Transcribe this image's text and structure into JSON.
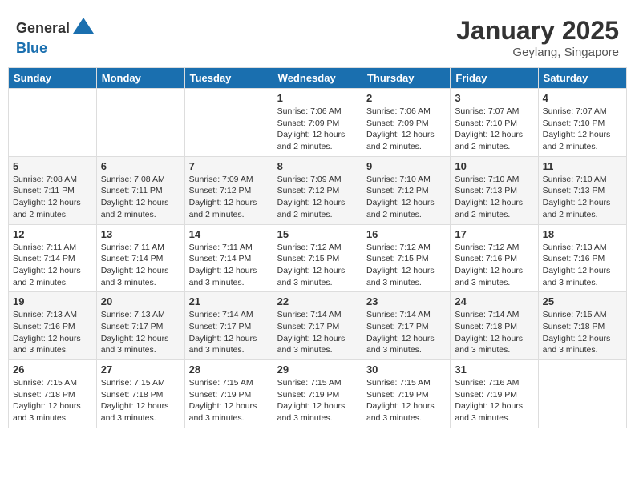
{
  "logo": {
    "general": "General",
    "blue": "Blue"
  },
  "title": "January 2025",
  "location": "Geylang, Singapore",
  "days_of_week": [
    "Sunday",
    "Monday",
    "Tuesday",
    "Wednesday",
    "Thursday",
    "Friday",
    "Saturday"
  ],
  "weeks": [
    [
      {
        "day": "",
        "info": ""
      },
      {
        "day": "",
        "info": ""
      },
      {
        "day": "",
        "info": ""
      },
      {
        "day": "1",
        "info": "Sunrise: 7:06 AM\nSunset: 7:09 PM\nDaylight: 12 hours and 2 minutes."
      },
      {
        "day": "2",
        "info": "Sunrise: 7:06 AM\nSunset: 7:09 PM\nDaylight: 12 hours and 2 minutes."
      },
      {
        "day": "3",
        "info": "Sunrise: 7:07 AM\nSunset: 7:10 PM\nDaylight: 12 hours and 2 minutes."
      },
      {
        "day": "4",
        "info": "Sunrise: 7:07 AM\nSunset: 7:10 PM\nDaylight: 12 hours and 2 minutes."
      }
    ],
    [
      {
        "day": "5",
        "info": "Sunrise: 7:08 AM\nSunset: 7:11 PM\nDaylight: 12 hours and 2 minutes."
      },
      {
        "day": "6",
        "info": "Sunrise: 7:08 AM\nSunset: 7:11 PM\nDaylight: 12 hours and 2 minutes."
      },
      {
        "day": "7",
        "info": "Sunrise: 7:09 AM\nSunset: 7:12 PM\nDaylight: 12 hours and 2 minutes."
      },
      {
        "day": "8",
        "info": "Sunrise: 7:09 AM\nSunset: 7:12 PM\nDaylight: 12 hours and 2 minutes."
      },
      {
        "day": "9",
        "info": "Sunrise: 7:10 AM\nSunset: 7:12 PM\nDaylight: 12 hours and 2 minutes."
      },
      {
        "day": "10",
        "info": "Sunrise: 7:10 AM\nSunset: 7:13 PM\nDaylight: 12 hours and 2 minutes."
      },
      {
        "day": "11",
        "info": "Sunrise: 7:10 AM\nSunset: 7:13 PM\nDaylight: 12 hours and 2 minutes."
      }
    ],
    [
      {
        "day": "12",
        "info": "Sunrise: 7:11 AM\nSunset: 7:14 PM\nDaylight: 12 hours and 2 minutes."
      },
      {
        "day": "13",
        "info": "Sunrise: 7:11 AM\nSunset: 7:14 PM\nDaylight: 12 hours and 3 minutes."
      },
      {
        "day": "14",
        "info": "Sunrise: 7:11 AM\nSunset: 7:14 PM\nDaylight: 12 hours and 3 minutes."
      },
      {
        "day": "15",
        "info": "Sunrise: 7:12 AM\nSunset: 7:15 PM\nDaylight: 12 hours and 3 minutes."
      },
      {
        "day": "16",
        "info": "Sunrise: 7:12 AM\nSunset: 7:15 PM\nDaylight: 12 hours and 3 minutes."
      },
      {
        "day": "17",
        "info": "Sunrise: 7:12 AM\nSunset: 7:16 PM\nDaylight: 12 hours and 3 minutes."
      },
      {
        "day": "18",
        "info": "Sunrise: 7:13 AM\nSunset: 7:16 PM\nDaylight: 12 hours and 3 minutes."
      }
    ],
    [
      {
        "day": "19",
        "info": "Sunrise: 7:13 AM\nSunset: 7:16 PM\nDaylight: 12 hours and 3 minutes."
      },
      {
        "day": "20",
        "info": "Sunrise: 7:13 AM\nSunset: 7:17 PM\nDaylight: 12 hours and 3 minutes."
      },
      {
        "day": "21",
        "info": "Sunrise: 7:14 AM\nSunset: 7:17 PM\nDaylight: 12 hours and 3 minutes."
      },
      {
        "day": "22",
        "info": "Sunrise: 7:14 AM\nSunset: 7:17 PM\nDaylight: 12 hours and 3 minutes."
      },
      {
        "day": "23",
        "info": "Sunrise: 7:14 AM\nSunset: 7:17 PM\nDaylight: 12 hours and 3 minutes."
      },
      {
        "day": "24",
        "info": "Sunrise: 7:14 AM\nSunset: 7:18 PM\nDaylight: 12 hours and 3 minutes."
      },
      {
        "day": "25",
        "info": "Sunrise: 7:15 AM\nSunset: 7:18 PM\nDaylight: 12 hours and 3 minutes."
      }
    ],
    [
      {
        "day": "26",
        "info": "Sunrise: 7:15 AM\nSunset: 7:18 PM\nDaylight: 12 hours and 3 minutes."
      },
      {
        "day": "27",
        "info": "Sunrise: 7:15 AM\nSunset: 7:18 PM\nDaylight: 12 hours and 3 minutes."
      },
      {
        "day": "28",
        "info": "Sunrise: 7:15 AM\nSunset: 7:19 PM\nDaylight: 12 hours and 3 minutes."
      },
      {
        "day": "29",
        "info": "Sunrise: 7:15 AM\nSunset: 7:19 PM\nDaylight: 12 hours and 3 minutes."
      },
      {
        "day": "30",
        "info": "Sunrise: 7:15 AM\nSunset: 7:19 PM\nDaylight: 12 hours and 3 minutes."
      },
      {
        "day": "31",
        "info": "Sunrise: 7:16 AM\nSunset: 7:19 PM\nDaylight: 12 hours and 3 minutes."
      },
      {
        "day": "",
        "info": ""
      }
    ]
  ]
}
